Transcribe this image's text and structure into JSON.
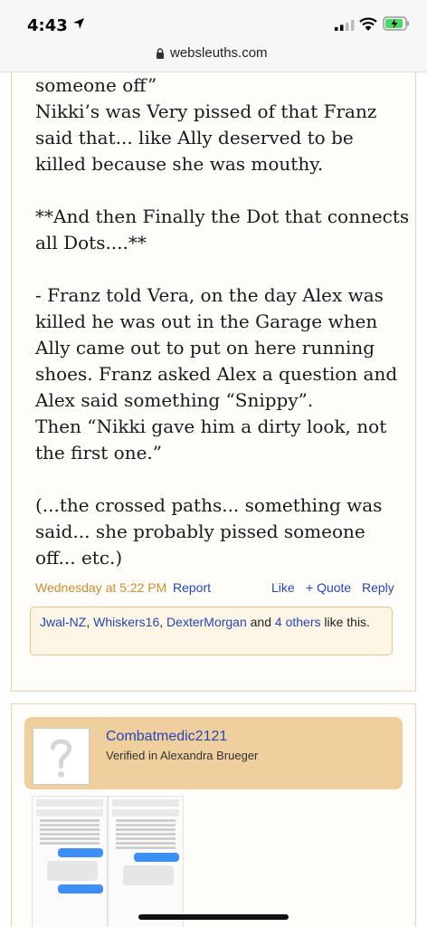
{
  "status": {
    "time": "4:43"
  },
  "browser": {
    "url": "websleuths.com"
  },
  "post1": {
    "paragraphs": [
      "someone off”\nNikki’s was Very pissed of that Franz said that... like Ally deserved to be killed because she was mouthy.",
      "**And then Finally the Dot that connects all Dots....**",
      "- Franz told Vera, on the day Alex was killed he was out in the Garage when Ally came out to put on here running shoes. Franz asked Alex a question and Alex said something “Snippy”.\nThen “Nikki gave him a dirty look, not the first one.”",
      "(...the crossed paths... something was said... she probably pissed someone off... etc.)"
    ],
    "timestamp": "Wednesday at 5:22 PM",
    "report_label": "Report",
    "like_label": "Like",
    "quote_label": "+ Quote",
    "reply_label": "Reply",
    "likes": {
      "user1": "Jwal-NZ",
      "user2": "Whiskers16",
      "user3": "DexterMorgan",
      "and_text": "and",
      "others": "4 others",
      "suffix": "like this."
    }
  },
  "post2": {
    "author_name": "Combatmedic2121",
    "author_title": "Verified in Alexandra Brueger"
  },
  "colors": {
    "link": "#2546b5",
    "timestamp": "#d18a2f",
    "card": "#f0cf9f",
    "likes_bg": "#fdf5e6"
  }
}
